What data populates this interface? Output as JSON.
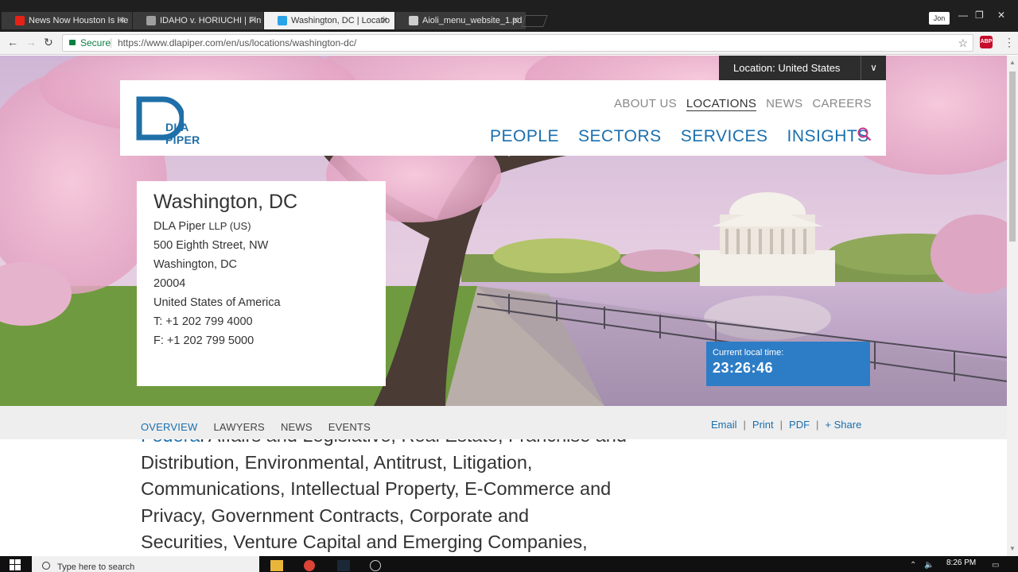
{
  "browser": {
    "tabs": [
      {
        "title": "News Now Houston Is He",
        "favicon_color": "#e62117"
      },
      {
        "title": "IDAHO v. HORIUCHI | Fin",
        "favicon_color": "#9e9e9e"
      },
      {
        "title": "Washington, DC | Locatio",
        "favicon_color": "#29a3e8"
      },
      {
        "title": "Aioli_menu_website_1.pd",
        "favicon_color": "#cccccc"
      }
    ],
    "profile_name": "Jon",
    "window_controls": {
      "minimize": "—",
      "restore": "❐",
      "close": "✕"
    },
    "secure_label": "Secure",
    "url": "https://www.dlapiper.com/en/us/locations/washington-dc/",
    "abp_label": "ABP"
  },
  "site": {
    "location_selector": "Location: United States",
    "logo_text": "DLA PIPER",
    "utility_nav": [
      "ABOUT US",
      "LOCATIONS",
      "NEWS",
      "CAREERS"
    ],
    "utility_nav_current": "LOCATIONS",
    "main_nav": [
      "PEOPLE",
      "SECTORS",
      "SERVICES",
      "INSIGHTS"
    ],
    "accent_color": "#1a6fae"
  },
  "office": {
    "city": "Washington, DC",
    "entity": "DLA Piper",
    "entity_suffix": "LLP (US)",
    "street": "500 Eighth Street, NW",
    "city_state": "Washington, DC",
    "zip": "20004",
    "country": "United States of America",
    "phone": "T: +1 202 799 4000",
    "fax": "F: +1 202 799 5000"
  },
  "local_time": {
    "label": "Current local time:",
    "value": "23:26:46"
  },
  "subnav": {
    "tabs": [
      "OVERVIEW",
      "LAWYERS",
      "NEWS",
      "EVENTS"
    ],
    "active": "OVERVIEW",
    "share_links": [
      "Email",
      "Print",
      "PDF",
      "+ Share"
    ]
  },
  "body_copy": {
    "link_text": "Federa",
    "lines": [
      "l Affairs and Legislative, Real Estate, Franchise and",
      "Distribution, Environmental, Antitrust, Litigation,",
      "Communications, Intellectual Property, E-Commerce and",
      "Privacy, Government Contracts, Corporate and",
      "Securities, Venture Capital and Emerging Companies,"
    ]
  },
  "taskbar": {
    "search_placeholder": "Type here to search",
    "clock": "8:26 PM"
  }
}
